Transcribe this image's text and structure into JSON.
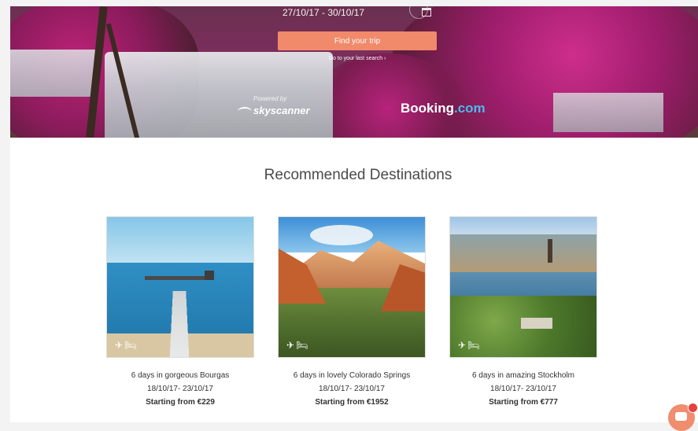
{
  "search": {
    "dates": "27/10/17 - 30/10/17",
    "find_button": "Find your trip",
    "last_search_link": "Go to your last search ›"
  },
  "partners": {
    "powered_by": "Powered by",
    "skyscanner": "skyscanner",
    "booking_main": "Booking",
    "booking_suffix": ".com"
  },
  "recommended": {
    "title": "Recommended Destinations",
    "cards": [
      {
        "title": "6 days in gorgeous Bourgas",
        "dates": "18/10/17- 23/10/17",
        "price": "Starting from €229",
        "icons": [
          "plane-icon",
          "bed-icon"
        ]
      },
      {
        "title": "6 days in lovely Colorado Springs",
        "dates": "18/10/17- 23/10/17",
        "price": "Starting from €1952",
        "icons": [
          "plane-icon",
          "bed-icon"
        ]
      },
      {
        "title": "6 days in amazing Stockholm",
        "dates": "18/10/17- 23/10/17",
        "price": "Starting from €777",
        "icons": [
          "plane-icon",
          "bed-icon"
        ]
      }
    ]
  },
  "colors": {
    "accent": "#f08a6a",
    "booking_blue": "#4db8f0",
    "chat_badge": "#e8413c"
  }
}
